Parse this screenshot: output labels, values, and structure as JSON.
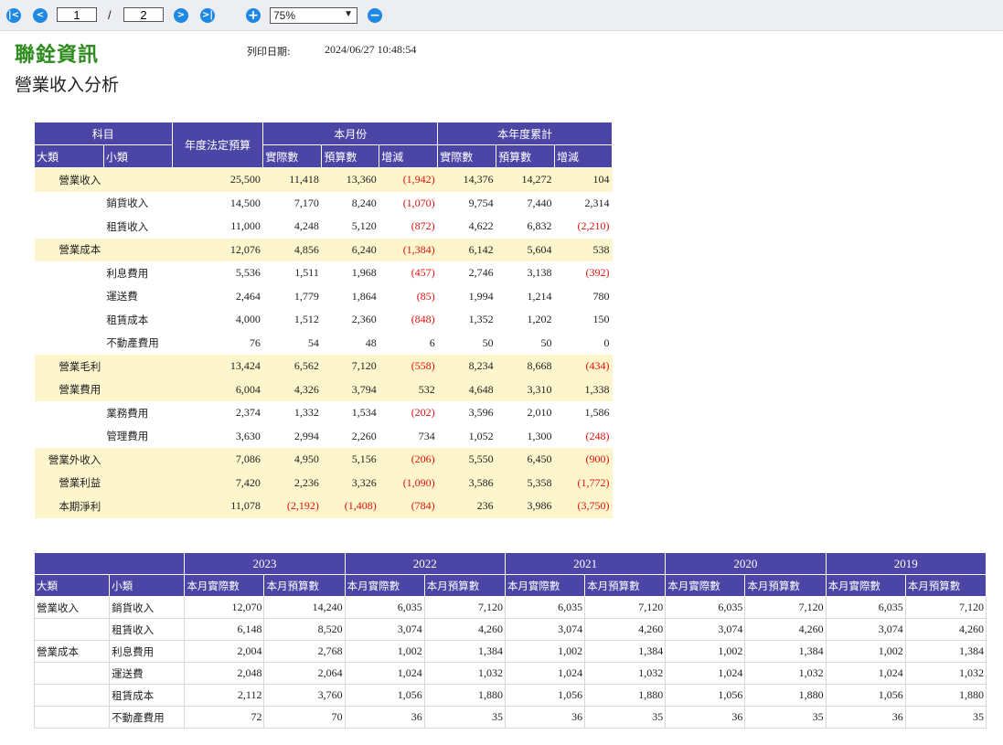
{
  "toolbar": {
    "current_page": "1",
    "separator": "/",
    "total_pages": "2",
    "zoom": "75%",
    "icons": [
      "first-page-icon",
      "prev-page-icon",
      "next-page-icon",
      "last-page-icon",
      "zoom-in-icon",
      "zoom-out-icon"
    ]
  },
  "header": {
    "company": "聯銓資訊",
    "title": "營業收入分析",
    "print_label": "列印日期:",
    "print_date": "2024/06/27 10:48:54"
  },
  "colors": {
    "header_bg": "#4b45a6",
    "category_bg": "#fdf6cc",
    "negative": "#e01010",
    "company": "#2e8b1e"
  },
  "summary": {
    "headers": {
      "subject": "科目",
      "budget": "年度法定預算",
      "month": "本月份",
      "ytd": "本年度累計",
      "major": "大類",
      "minor": "小類",
      "actual": "實際數",
      "planned": "預算數",
      "diff": "增減"
    },
    "rows": [
      {
        "type": "main",
        "major": "營業收入",
        "minor": "",
        "budget": "25,500",
        "m_actual": "11,418",
        "m_plan": "13,360",
        "m_diff": "(1,942)",
        "y_actual": "14,376",
        "y_plan": "14,272",
        "y_diff": "104"
      },
      {
        "type": "sub",
        "major": "",
        "minor": "銷貨收入",
        "budget": "14,500",
        "m_actual": "7,170",
        "m_plan": "8,240",
        "m_diff": "(1,070)",
        "y_actual": "9,754",
        "y_plan": "7,440",
        "y_diff": "2,314"
      },
      {
        "type": "sub",
        "major": "",
        "minor": "租賃收入",
        "budget": "11,000",
        "m_actual": "4,248",
        "m_plan": "5,120",
        "m_diff": "(872)",
        "y_actual": "4,622",
        "y_plan": "6,832",
        "y_diff": "(2,210)"
      },
      {
        "type": "main",
        "major": "營業成本",
        "minor": "",
        "budget": "12,076",
        "m_actual": "4,856",
        "m_plan": "6,240",
        "m_diff": "(1,384)",
        "y_actual": "6,142",
        "y_plan": "5,604",
        "y_diff": "538"
      },
      {
        "type": "sub",
        "major": "",
        "minor": "利息費用",
        "budget": "5,536",
        "m_actual": "1,511",
        "m_plan": "1,968",
        "m_diff": "(457)",
        "y_actual": "2,746",
        "y_plan": "3,138",
        "y_diff": "(392)"
      },
      {
        "type": "sub",
        "major": "",
        "minor": "運送費",
        "budget": "2,464",
        "m_actual": "1,779",
        "m_plan": "1,864",
        "m_diff": "(85)",
        "y_actual": "1,994",
        "y_plan": "1,214",
        "y_diff": "780"
      },
      {
        "type": "sub",
        "major": "",
        "minor": "租賃成本",
        "budget": "4,000",
        "m_actual": "1,512",
        "m_plan": "2,360",
        "m_diff": "(848)",
        "y_actual": "1,352",
        "y_plan": "1,202",
        "y_diff": "150"
      },
      {
        "type": "sub",
        "major": "",
        "minor": "不動產費用",
        "budget": "76",
        "m_actual": "54",
        "m_plan": "48",
        "m_diff": "6",
        "y_actual": "50",
        "y_plan": "50",
        "y_diff": "0"
      },
      {
        "type": "main",
        "major": "營業毛利",
        "minor": "",
        "budget": "13,424",
        "m_actual": "6,562",
        "m_plan": "7,120",
        "m_diff": "(558)",
        "y_actual": "8,234",
        "y_plan": "8,668",
        "y_diff": "(434)"
      },
      {
        "type": "main",
        "major": "營業費用",
        "minor": "",
        "budget": "6,004",
        "m_actual": "4,326",
        "m_plan": "3,794",
        "m_diff": "532",
        "y_actual": "4,648",
        "y_plan": "3,310",
        "y_diff": "1,338"
      },
      {
        "type": "sub",
        "major": "",
        "minor": "業務費用",
        "budget": "2,374",
        "m_actual": "1,332",
        "m_plan": "1,534",
        "m_diff": "(202)",
        "y_actual": "3,596",
        "y_plan": "2,010",
        "y_diff": "1,586"
      },
      {
        "type": "sub",
        "major": "",
        "minor": "管理費用",
        "budget": "3,630",
        "m_actual": "2,994",
        "m_plan": "2,260",
        "m_diff": "734",
        "y_actual": "1,052",
        "y_plan": "1,300",
        "y_diff": "(248)"
      },
      {
        "type": "main",
        "major": "營業外收入",
        "minor": "",
        "budget": "7,086",
        "m_actual": "4,950",
        "m_plan": "5,156",
        "m_diff": "(206)",
        "y_actual": "5,550",
        "y_plan": "6,450",
        "y_diff": "(900)"
      },
      {
        "type": "main",
        "major": "營業利益",
        "minor": "",
        "budget": "7,420",
        "m_actual": "2,236",
        "m_plan": "3,326",
        "m_diff": "(1,090)",
        "y_actual": "3,586",
        "y_plan": "5,358",
        "y_diff": "(1,772)"
      },
      {
        "type": "main",
        "major": "本期淨利",
        "minor": "",
        "budget": "11,078",
        "m_actual": "(2,192)",
        "m_plan": "(1,408)",
        "m_diff": "(784)",
        "y_actual": "236",
        "y_plan": "3,986",
        "y_diff": "(3,750)"
      }
    ]
  },
  "history": {
    "headers": {
      "major": "大類",
      "minor": "小類",
      "actual": "本月實際數",
      "planned": "本月預算數"
    },
    "years": [
      "2023",
      "2022",
      "2021",
      "2020",
      "2019"
    ],
    "rows": [
      {
        "major": "營業收入",
        "minor": "銷貨收入",
        "values": [
          "12,070",
          "14,240",
          "6,035",
          "7,120",
          "6,035",
          "7,120",
          "6,035",
          "7,120",
          "6,035",
          "7,120"
        ]
      },
      {
        "major": "",
        "minor": "租賃收入",
        "values": [
          "6,148",
          "8,520",
          "3,074",
          "4,260",
          "3,074",
          "4,260",
          "3,074",
          "4,260",
          "3,074",
          "4,260"
        ]
      },
      {
        "major": "營業成本",
        "minor": "利息費用",
        "values": [
          "2,004",
          "2,768",
          "1,002",
          "1,384",
          "1,002",
          "1,384",
          "1,002",
          "1,384",
          "1,002",
          "1,384"
        ]
      },
      {
        "major": "",
        "minor": "運送費",
        "values": [
          "2,048",
          "2,064",
          "1,024",
          "1,032",
          "1,024",
          "1,032",
          "1,024",
          "1,032",
          "1,024",
          "1,032"
        ]
      },
      {
        "major": "",
        "minor": "租賃成本",
        "values": [
          "2,112",
          "3,760",
          "1,056",
          "1,880",
          "1,056",
          "1,880",
          "1,056",
          "1,880",
          "1,056",
          "1,880"
        ]
      },
      {
        "major": "",
        "minor": "不動產費用",
        "values": [
          "72",
          "70",
          "36",
          "35",
          "36",
          "35",
          "36",
          "35",
          "36",
          "35"
        ]
      }
    ]
  }
}
